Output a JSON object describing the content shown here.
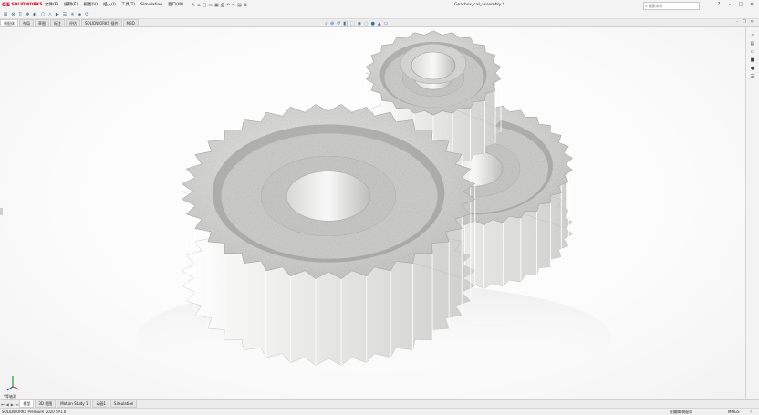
{
  "app": {
    "brand": "SOLIDWORKS",
    "document_title": "Gearbox_cal_assembly *",
    "search_placeholder": "搜索命令"
  },
  "menus": [
    "文件(F)",
    "编辑(E)",
    "视图(V)",
    "插入(I)",
    "工具(T)",
    "Simulation",
    "窗口(W)"
  ],
  "command_tabs": [
    "装配体",
    "布局",
    "草图",
    "标注",
    "评估",
    "SOLIDWORKS 插件",
    "MBD"
  ],
  "bottom_tabs": [
    "模型",
    "3D 视图",
    "Motion Study 1",
    "动画1",
    "Simulation"
  ],
  "view": {
    "current_view": "*等轴测"
  },
  "status": {
    "version": "SOLIDWORKS Premium 2020 SP1.0",
    "state": "在编辑 装配体",
    "units": "MMGS",
    "help": "?"
  },
  "colors": {
    "metal_light": "#e6e6e4",
    "metal_shadow": "#8f8f8d",
    "brand_red": "#d6001c"
  }
}
